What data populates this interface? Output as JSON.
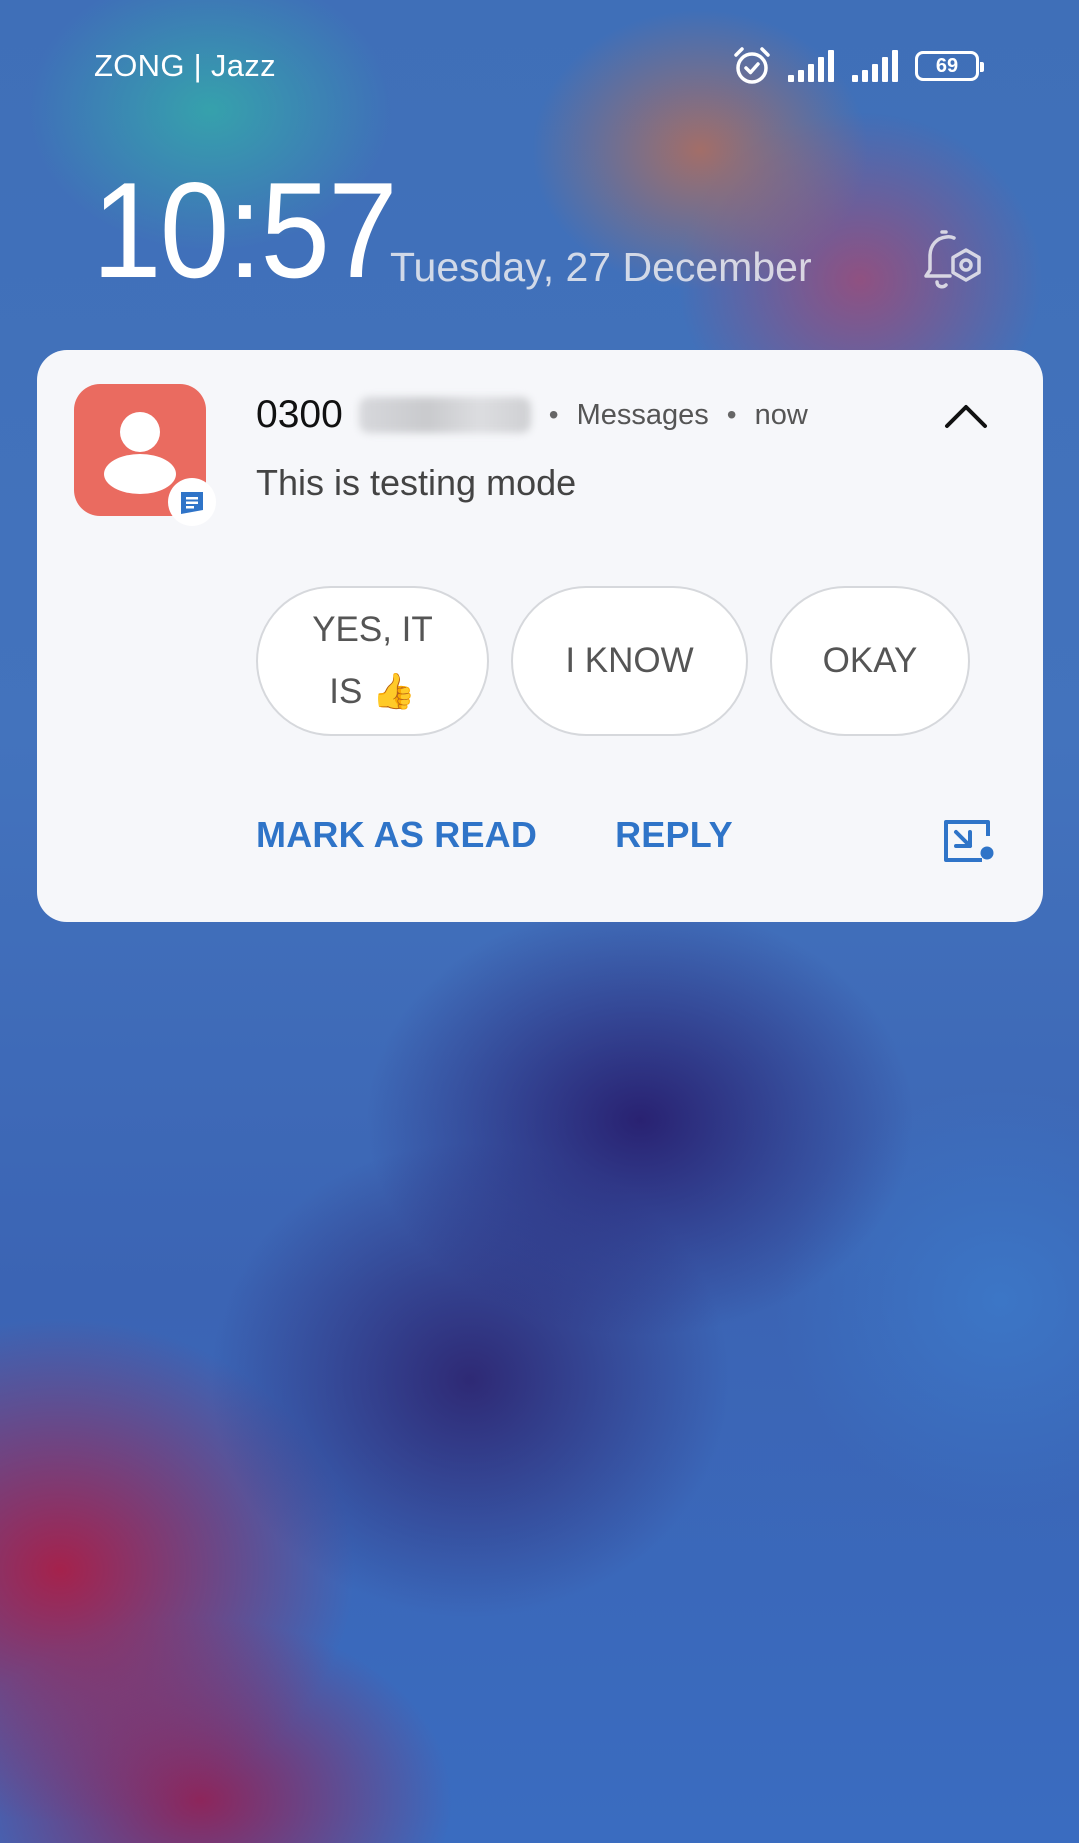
{
  "status_bar": {
    "carrier": "ZONG | Jazz",
    "battery_level": "69",
    "icons": [
      "alarm-icon",
      "signal-icon",
      "signal-icon",
      "battery-icon"
    ]
  },
  "lock_screen": {
    "time": "10:57",
    "date": "Tuesday, 27 December",
    "settings_icon": "bell-settings-icon"
  },
  "notification": {
    "sender_prefix": "0300",
    "app_name": "Messages",
    "time": "now",
    "separator": "•",
    "message": "This is testing mode",
    "smart_replies": [
      {
        "line1": "YES, IT",
        "line2": "IS",
        "emoji": "👍"
      },
      {
        "label": "I KNOW"
      },
      {
        "label": "OKAY"
      }
    ],
    "actions": {
      "mark_as_read": "MARK AS READ",
      "reply": "REPLY"
    },
    "colors": {
      "avatar_bg": "#ea6b60",
      "action_blue": "#2f74c8",
      "card_bg": "#f6f7fa"
    }
  }
}
